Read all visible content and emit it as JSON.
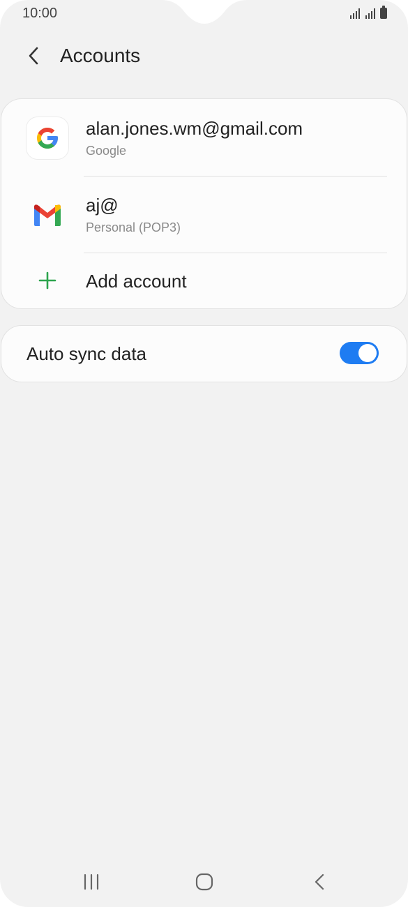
{
  "status_bar": {
    "time": "10:00"
  },
  "header": {
    "title": "Accounts"
  },
  "accounts": [
    {
      "name": "alan.jones.wm@gmail.com",
      "type": "Google",
      "icon": "google-icon"
    },
    {
      "name": "aj@",
      "type": "Personal (POP3)",
      "icon": "gmail-icon"
    }
  ],
  "add_account": {
    "label": "Add account",
    "icon": "plus-icon"
  },
  "auto_sync": {
    "label": "Auto sync data",
    "enabled": true
  },
  "colors": {
    "accent": "#1e7cf2",
    "add_green": "#2da44e",
    "background": "#f2f2f2"
  }
}
